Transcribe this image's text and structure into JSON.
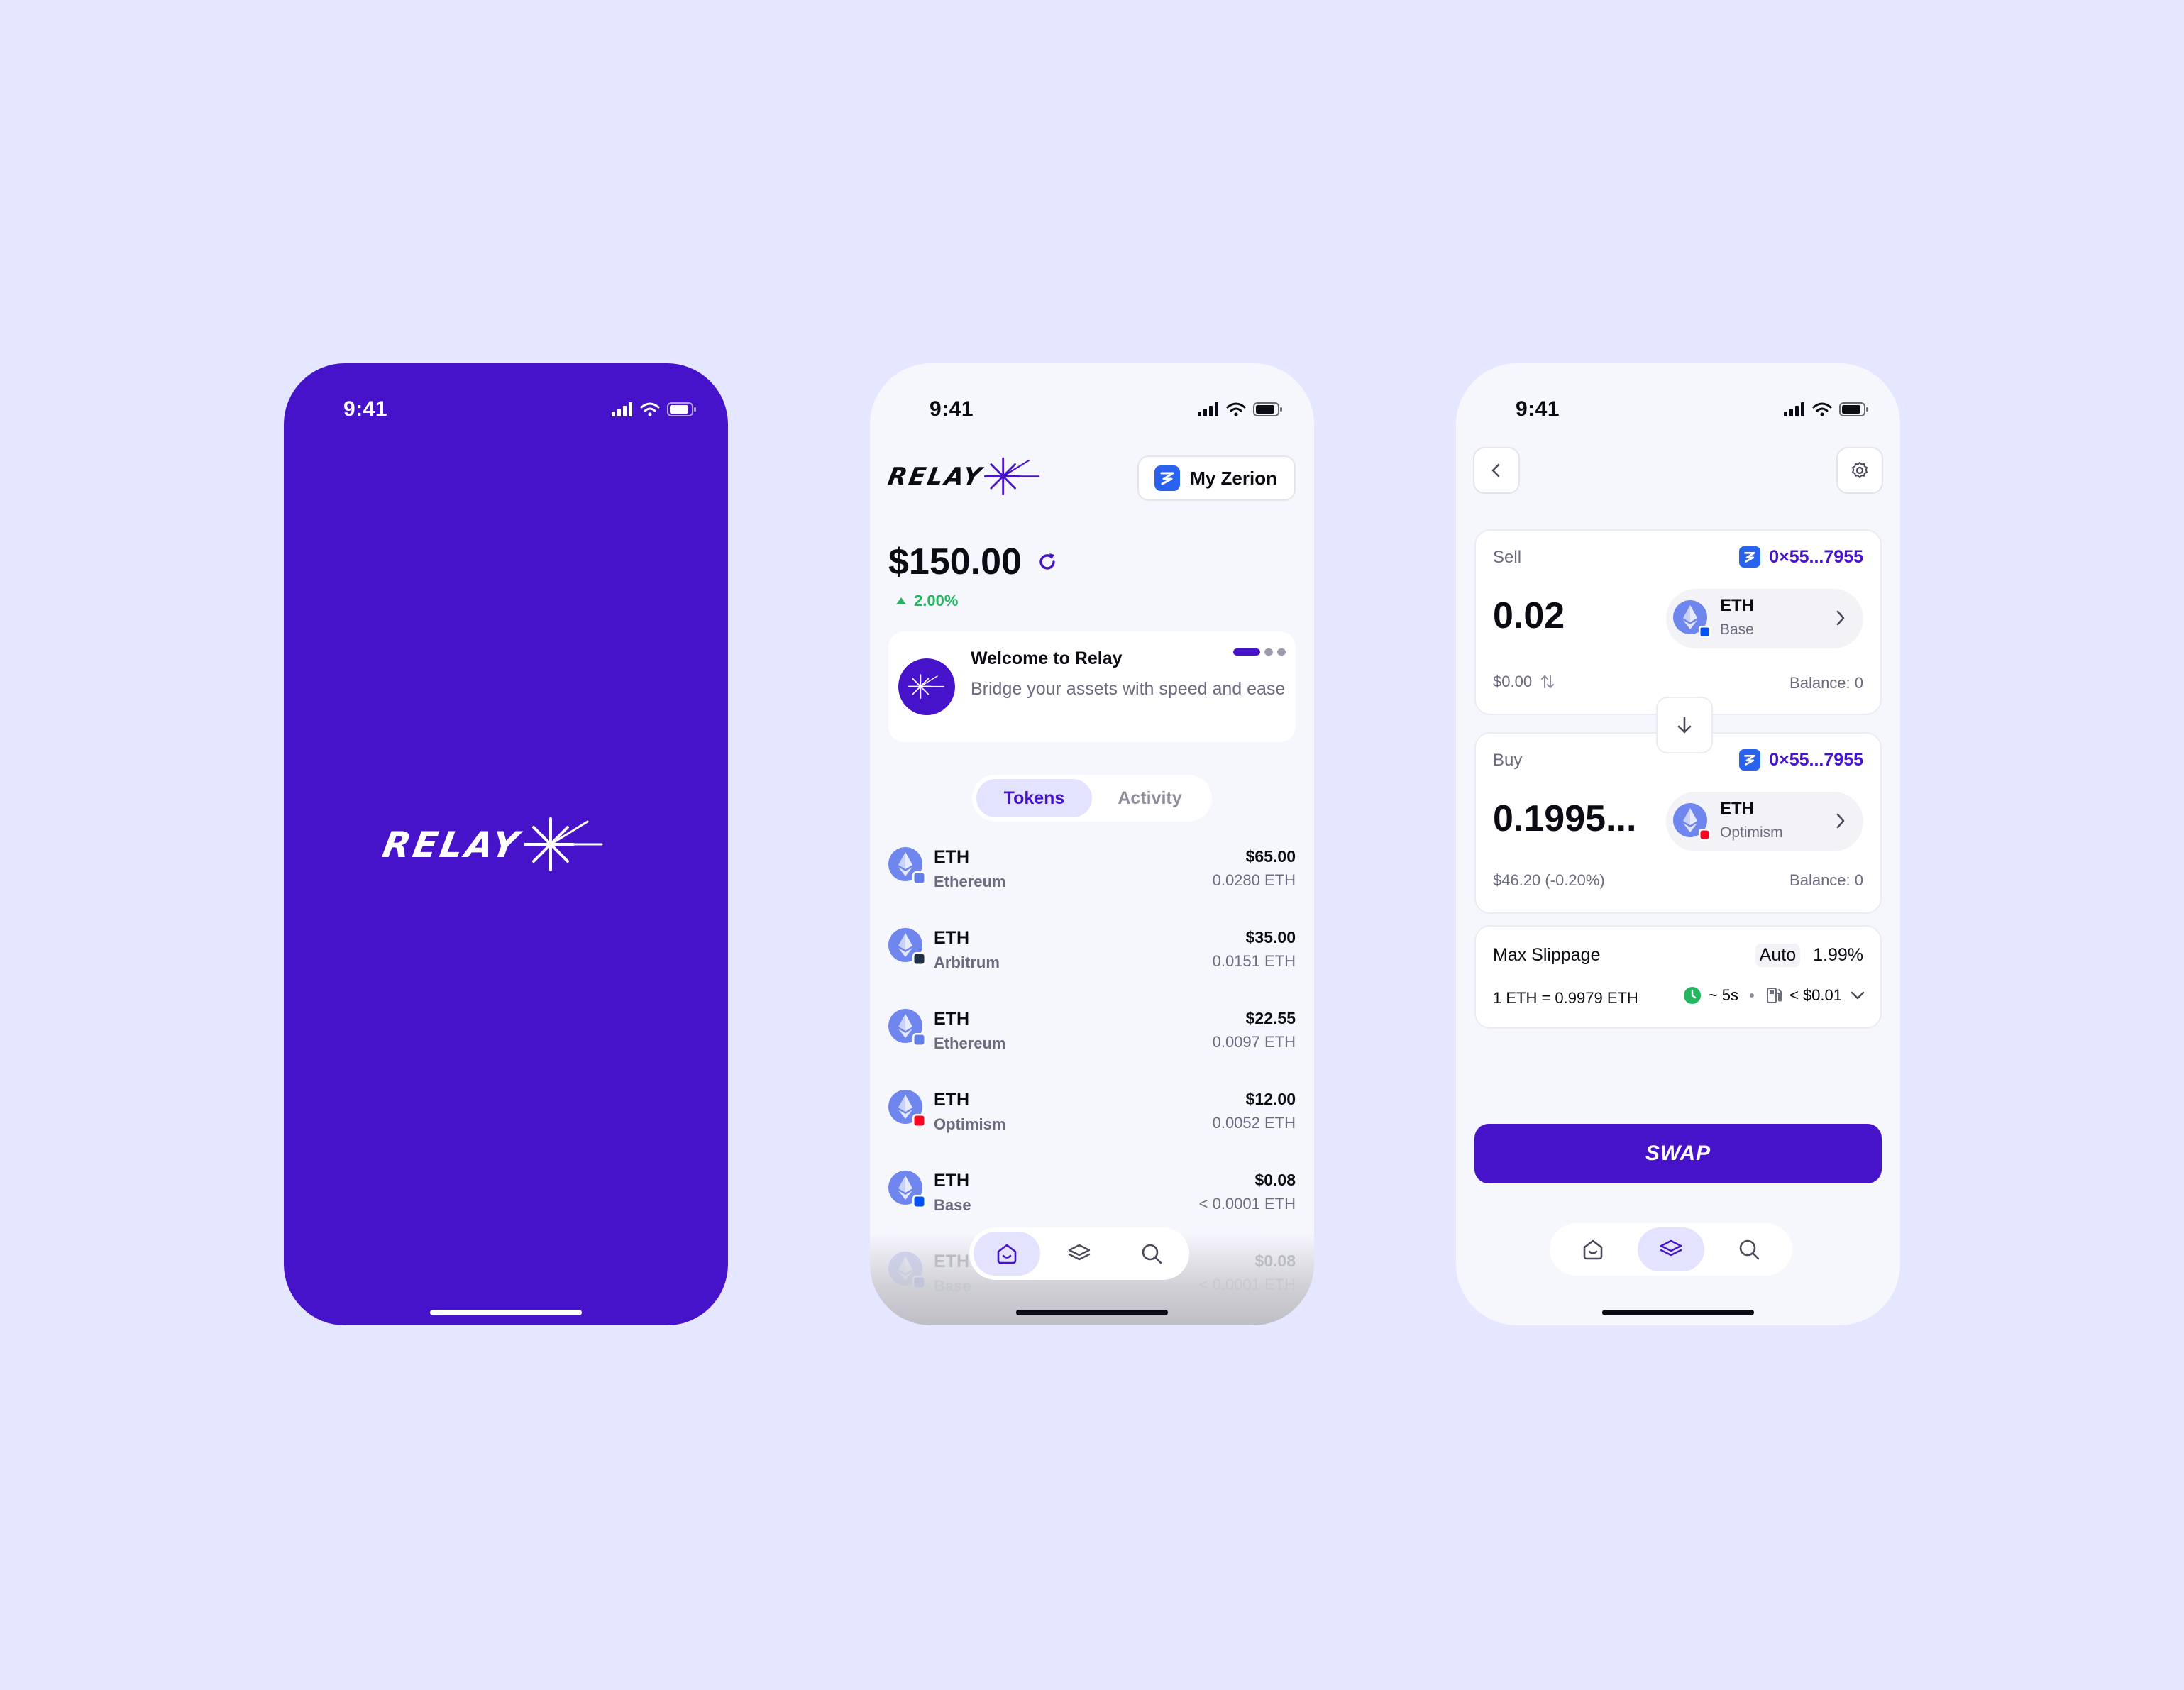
{
  "status_time": "9:41",
  "splash": {
    "logo_text": "RELAY"
  },
  "wallet": {
    "logo_text": "RELAY",
    "zerion_button": "My Zerion",
    "balance": "$150.00",
    "change": "2.00%",
    "welcome_title": "Welcome to Relay",
    "welcome_text": "Bridge your assets with speed and ease",
    "tabs": [
      "Tokens",
      "Activity"
    ],
    "active_tab": "Tokens",
    "tokens": [
      {
        "symbol": "ETH",
        "chain": "Ethereum",
        "usd": "$65.00",
        "amount": "0.0280 ETH",
        "badge_color": "#627EEA"
      },
      {
        "symbol": "ETH",
        "chain": "Arbitrum",
        "usd": "$35.00",
        "amount": "0.0151 ETH",
        "badge_color": "#213147"
      },
      {
        "symbol": "ETH",
        "chain": "Ethereum",
        "usd": "$22.55",
        "amount": "0.0097 ETH",
        "badge_color": "#627EEA"
      },
      {
        "symbol": "ETH",
        "chain": "Optimism",
        "usd": "$12.00",
        "amount": "0.0052 ETH",
        "badge_color": "#FF0420"
      },
      {
        "symbol": "ETH",
        "chain": "Base",
        "usd": "$0.08",
        "amount": "< 0.0001 ETH",
        "badge_color": "#0052FF"
      },
      {
        "symbol": "ETH",
        "chain": "Base",
        "usd": "$0.08",
        "amount": "< 0.0001 ETH",
        "badge_color": "#0052FF"
      }
    ]
  },
  "swap": {
    "sell_label": "Sell",
    "sell_address": "0×55...7955",
    "sell_amount": "0.02",
    "sell_token": "ETH",
    "sell_chain": "Base",
    "sell_usd": "$0.00",
    "sell_balance": "Balance: 0",
    "buy_label": "Buy",
    "buy_address": "0×55...7955",
    "buy_amount": "0.1995...",
    "buy_token": "ETH",
    "buy_chain": "Optimism",
    "buy_usd": "$46.20 (-0.20%)",
    "buy_balance": "Balance: 0",
    "slippage_label": "Max Slippage",
    "slippage_mode": "Auto",
    "slippage_value": "1.99%",
    "rate": "1 ETH = 0.9979 ETH",
    "time": "~ 5s",
    "fee": "< $0.01",
    "swap_button": "SWAP"
  },
  "colors": {
    "brand": "#4612CA",
    "accent_soft": "#E3E3FF",
    "positive": "#22B65F",
    "zerion": "#2962EF"
  },
  "icons": [
    "signal-icon",
    "wifi-icon",
    "battery-icon",
    "refresh-icon",
    "home-icon",
    "layers-icon",
    "search-icon",
    "back-icon",
    "gear-icon",
    "arrow-down-icon",
    "clock-icon",
    "gas-icon",
    "chevron-down-icon",
    "chevron-right-icon"
  ]
}
